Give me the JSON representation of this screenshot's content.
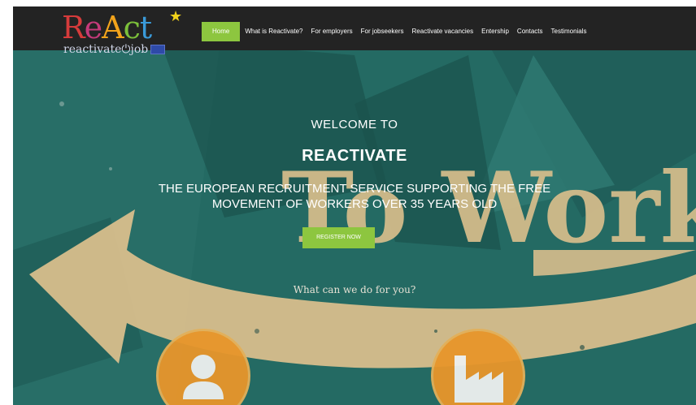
{
  "logo": {
    "main_parts": [
      "R",
      "e",
      "A",
      "c",
      "t"
    ],
    "star": "★",
    "subtitle": "reactivate⏻job"
  },
  "nav": {
    "items": [
      {
        "label": "Home",
        "active": true
      },
      {
        "label": "What is Reactivate?",
        "active": false
      },
      {
        "label": "For employers",
        "active": false
      },
      {
        "label": "For jobseekers",
        "active": false
      },
      {
        "label": "Reactivate vacancies",
        "active": false
      },
      {
        "label": "Entership",
        "active": false
      },
      {
        "label": "Contacts",
        "active": false
      },
      {
        "label": "Testimonials",
        "active": false
      }
    ]
  },
  "hero": {
    "welcome": "WELCOME TO",
    "brand": "REACTIVATE",
    "tagline_line1": "THE EUROPEAN RECRUITMENT SERVICE SUPPORTING THE FREE",
    "tagline_line2": "MOVEMENT OF WORKERS OVER 35 YEARS OLD",
    "cta_label": "REGISTER NOW",
    "question": "What can we do for you?",
    "background_text": "To Work"
  },
  "services": [
    {
      "icon": "person-icon"
    },
    {
      "icon": "factory-icon"
    }
  ],
  "colors": {
    "accent": "#8dc63f",
    "nav_bg": "#232323",
    "teal": "#23655f",
    "tan": "#d8be8c",
    "orange": "#e8962b"
  }
}
